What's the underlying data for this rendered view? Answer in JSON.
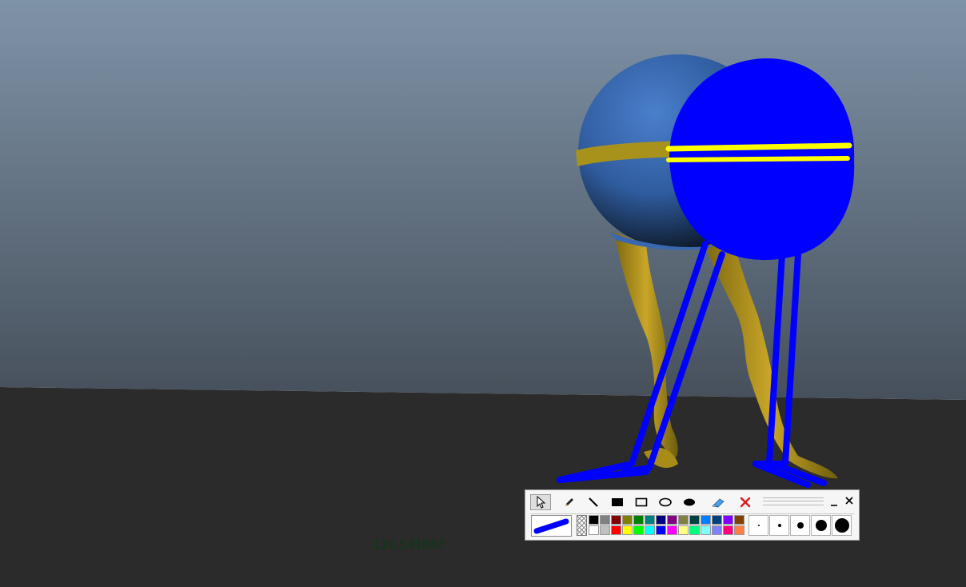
{
  "viewport": {
    "readout": "110.541667",
    "colors": {
      "sky_top": "#7f93a8",
      "sky_bottom": "#46505b",
      "floor": "#2b2b2b",
      "model_body": "#3a68b0",
      "model_band": "#a8921c",
      "model_legs": "#b89a22",
      "annotation_blue": "#0000ff",
      "annotation_yellow": "#ffff00"
    }
  },
  "toolbar": {
    "tools": [
      {
        "name": "select-tool",
        "icon": "arrow-cursor-icon",
        "active": true
      },
      {
        "name": "pencil-tool",
        "icon": "pencil-icon",
        "active": false
      },
      {
        "name": "line-tool",
        "icon": "line-icon",
        "active": false
      },
      {
        "name": "filled-rectangle-tool",
        "icon": "filled-rectangle-icon",
        "active": false
      },
      {
        "name": "rectangle-tool",
        "icon": "rectangle-icon",
        "active": false
      },
      {
        "name": "ellipse-tool",
        "icon": "ellipse-icon",
        "active": false
      },
      {
        "name": "filled-ellipse-tool",
        "icon": "filled-ellipse-icon",
        "active": false
      },
      {
        "name": "eraser-tool",
        "icon": "eraser-icon",
        "active": false
      },
      {
        "name": "clear-tool",
        "icon": "red-x-icon",
        "active": false
      }
    ],
    "current_color": "#0000ff",
    "palette_row1": [
      "#000000",
      "#808080",
      "#800000",
      "#808000",
      "#008000",
      "#008080",
      "#000080",
      "#800080",
      "#808040",
      "#004040",
      "#0080ff",
      "#004080",
      "#8000ff",
      "#804000"
    ],
    "palette_row2": [
      "#ffffff",
      "#c0c0c0",
      "#ff0000",
      "#ffff00",
      "#00ff00",
      "#00ffff",
      "#0000ff",
      "#ff00ff",
      "#ffff80",
      "#00ff80",
      "#80ffff",
      "#8080ff",
      "#ff0080",
      "#ff8040"
    ],
    "brush_sizes": [
      2,
      4,
      8,
      14,
      18
    ]
  }
}
